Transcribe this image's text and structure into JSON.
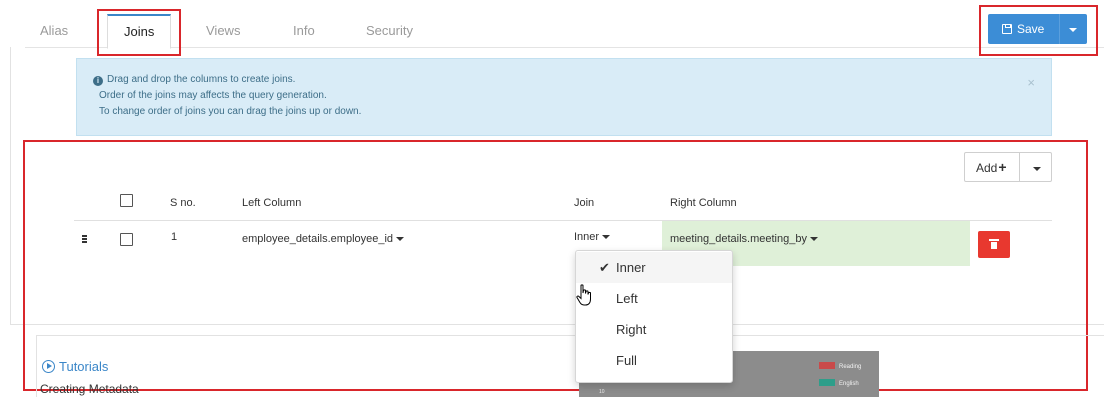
{
  "tabs": [
    "Alias",
    "Joins",
    "Views",
    "Info",
    "Security"
  ],
  "active_tab": "Joins",
  "save": {
    "label": "Save"
  },
  "alert": {
    "line1": "Drag and drop the columns to create joins.",
    "line2": "Order of the joins may affects the query generation.",
    "line3": "To change order of joins you can drag the joins up or down.",
    "close": "×"
  },
  "add": {
    "label": "Add"
  },
  "table": {
    "headers": {
      "sno": "S no.",
      "left": "Left Column",
      "join": "Join",
      "right": "Right Column"
    },
    "rows": [
      {
        "sno": "1",
        "left": "employee_details.employee_id",
        "join": "Inner",
        "right": "meeting_details.meeting_by"
      }
    ]
  },
  "join_menu": {
    "options": [
      "Inner",
      "Left",
      "Right",
      "Full"
    ],
    "selected": "Inner"
  },
  "tutorials": {
    "label": "Tutorials",
    "item": "Creating Metadata"
  },
  "thumbnail": {
    "legend": [
      "Reading",
      "English"
    ],
    "tick": "10"
  },
  "colors": {
    "primary": "#3c8dd6",
    "danger": "#e8382f",
    "highlight_box": "#d9262b",
    "alert_bg": "#d9ecf7",
    "right_cell_bg": "#dff0d8",
    "legend_reading": "#c94a4a",
    "legend_english": "#2e9e8a"
  }
}
